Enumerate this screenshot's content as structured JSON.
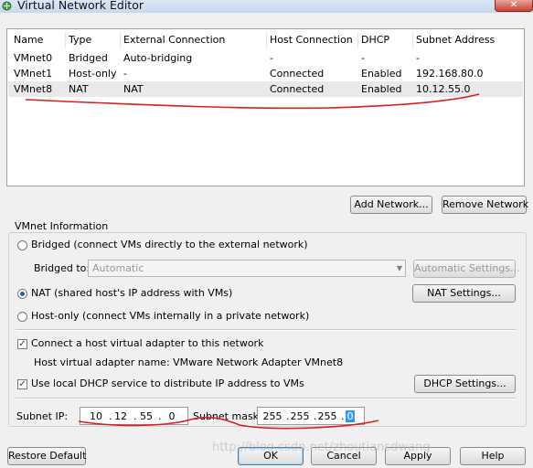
{
  "window": {
    "title": "Virtual Network Editor",
    "close_glyph": "✕",
    "app_icon": "vmware-network-icon"
  },
  "network_table": {
    "columns": [
      "Name",
      "Type",
      "External Connection",
      "Host Connection",
      "DHCP",
      "Subnet Address"
    ],
    "rows": [
      [
        "VMnet0",
        "Bridged",
        "Auto-bridging",
        "-",
        "-",
        "-"
      ],
      [
        "VMnet1",
        "Host-only",
        "-",
        "Connected",
        "Enabled",
        "192.168.80.0"
      ],
      [
        "VMnet8",
        "NAT",
        "NAT",
        "Connected",
        "Enabled",
        "10.12.55.0"
      ]
    ],
    "selected_row": 2
  },
  "table_buttons": {
    "add_network": "Add Network...",
    "remove_network": "Remove Network"
  },
  "vmnet_info": {
    "group_title": "VMnet Information",
    "bridged_label": "Bridged (connect VMs directly to the external network)",
    "bridged_to_label": "Bridged to:",
    "bridged_to_value": "Automatic",
    "auto_settings_button": "Automatic Settings...",
    "nat_label": "NAT (shared host's IP address with VMs)",
    "nat_settings_button": "NAT Settings...",
    "hostonly_label": "Host-only (connect VMs internally in a private network)",
    "selected_mode": "NAT",
    "connect_adapter_label": "Connect a host virtual adapter to this network",
    "connect_adapter_checked": true,
    "adapter_name_text": "Host virtual adapter name: VMware Network Adapter VMnet8",
    "dhcp_label": "Use local DHCP service to distribute IP address to VMs",
    "dhcp_checked": true,
    "dhcp_settings_button": "DHCP Settings...",
    "subnet_ip_label": "Subnet IP:",
    "subnet_ip": [
      "10",
      "12",
      "55",
      "0"
    ],
    "subnet_mask_label": "Subnet mask:",
    "subnet_mask": [
      "255",
      "255",
      "255",
      "0"
    ]
  },
  "footer": {
    "restore_default": "Restore Default",
    "ok": "OK",
    "cancel": "Cancel",
    "apply": "Apply",
    "help": "Help"
  },
  "watermark_text": "http://blog.csdn.net/zhoutiansdwang",
  "colors": {
    "selection_blue": "#3399ff",
    "annotation_red": "#d62020",
    "selected_row_bg": "#e9e9e9"
  }
}
